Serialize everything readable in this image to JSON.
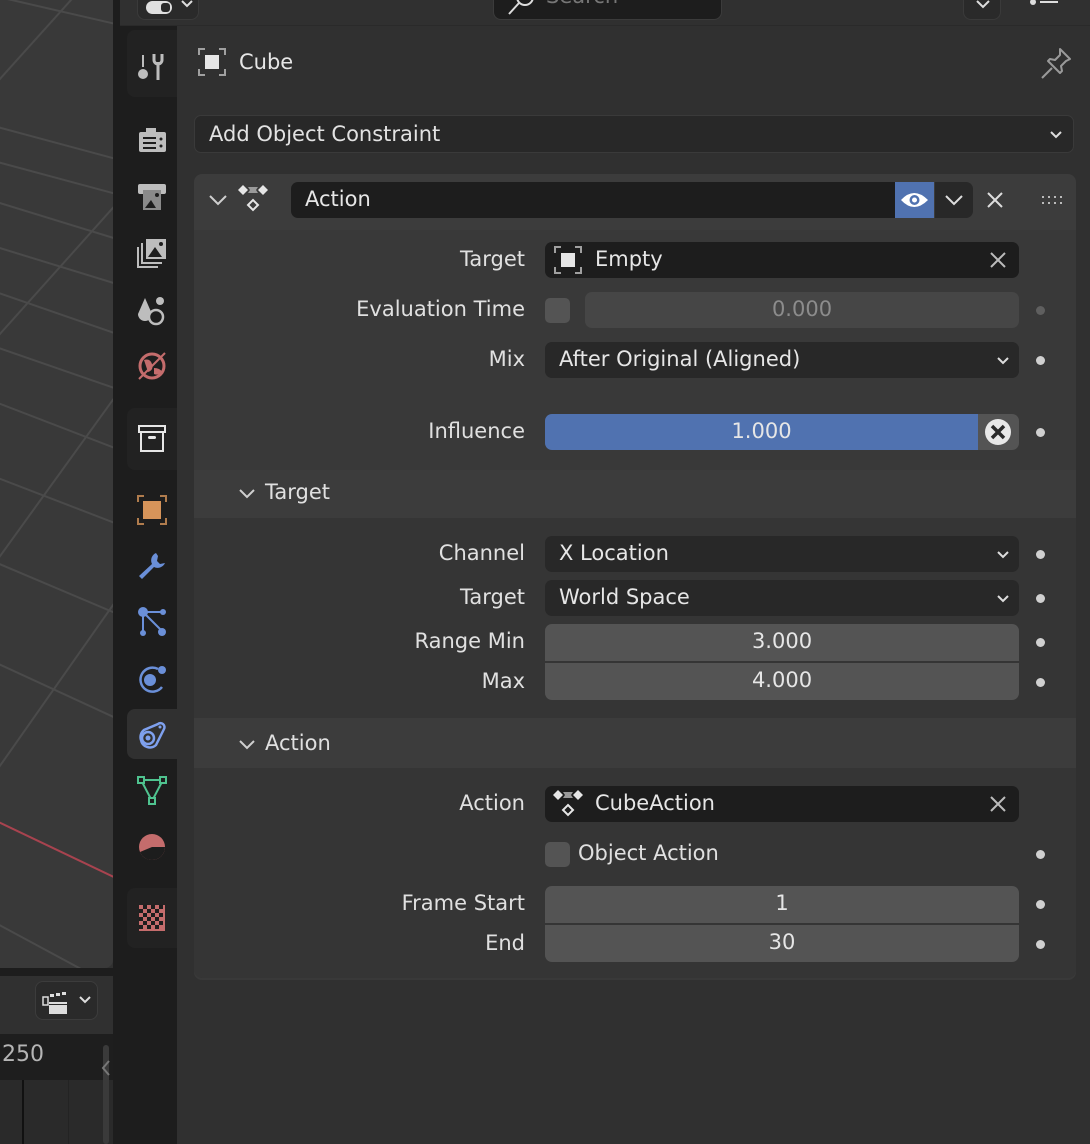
{
  "header": {
    "search_placeholder": "Search"
  },
  "tabs": [
    {
      "name": "tool",
      "icon": "tool-icon",
      "color": "#bdbdbd"
    },
    {
      "name": "render",
      "icon": "render-icon",
      "color": "#bdbdbd"
    },
    {
      "name": "output",
      "icon": "output-icon",
      "color": "#bdbdbd"
    },
    {
      "name": "view-layer",
      "icon": "view-layer-icon",
      "color": "#bdbdbd"
    },
    {
      "name": "scene",
      "icon": "scene-icon",
      "color": "#bdbdbd"
    },
    {
      "name": "world",
      "icon": "world-icon",
      "color": "#c46c6c"
    },
    {
      "name": "collection",
      "icon": "collection-icon",
      "color": "#e6e6e6"
    },
    {
      "name": "object",
      "icon": "object-icon",
      "color": "#d6945a"
    },
    {
      "name": "modifiers",
      "icon": "wrench-icon",
      "color": "#6a8fd8"
    },
    {
      "name": "particles",
      "icon": "particles-icon",
      "color": "#6a8fd8"
    },
    {
      "name": "physics",
      "icon": "physics-icon",
      "color": "#6a8fd8"
    },
    {
      "name": "constraints",
      "icon": "object-constraint-icon",
      "color": "#7ea0ee",
      "active": true
    },
    {
      "name": "data",
      "icon": "mesh-data-icon",
      "color": "#4fc38f"
    },
    {
      "name": "material",
      "icon": "material-icon",
      "color": "#c46c6c"
    },
    {
      "name": "texture",
      "icon": "texture-icon",
      "color": "#c46c6c"
    }
  ],
  "context": {
    "object_name": "Cube"
  },
  "add_constraint": {
    "label": "Add Object Constraint"
  },
  "constraint": {
    "name": "Action",
    "enabled": true,
    "target_label": "Target",
    "target_value": "Empty",
    "eval_time_label": "Evaluation Time",
    "eval_time_checked": false,
    "eval_time_value": "0.000",
    "mix_label": "Mix",
    "mix_value": "After Original (Aligned)",
    "influence_label": "Influence",
    "influence_value": "1.000",
    "influence_fraction": 1.0
  },
  "target_section": {
    "title": "Target",
    "channel_label": "Channel",
    "channel_value": "X Location",
    "space_label": "Target",
    "space_value": "World Space",
    "range_min_label": "Range Min",
    "range_min_value": "3.000",
    "range_max_label": "Max",
    "range_max_value": "4.000"
  },
  "action_section": {
    "title": "Action",
    "action_label": "Action",
    "action_value": "CubeAction",
    "object_action_label": "Object Action",
    "object_action_checked": false,
    "frame_start_label": "Frame Start",
    "frame_start_value": "1",
    "frame_end_label": "End",
    "frame_end_value": "30"
  },
  "timeline": {
    "end_frame": "250"
  },
  "colors": {
    "accent": "#5072b0",
    "axis_x": "#a8434f"
  }
}
